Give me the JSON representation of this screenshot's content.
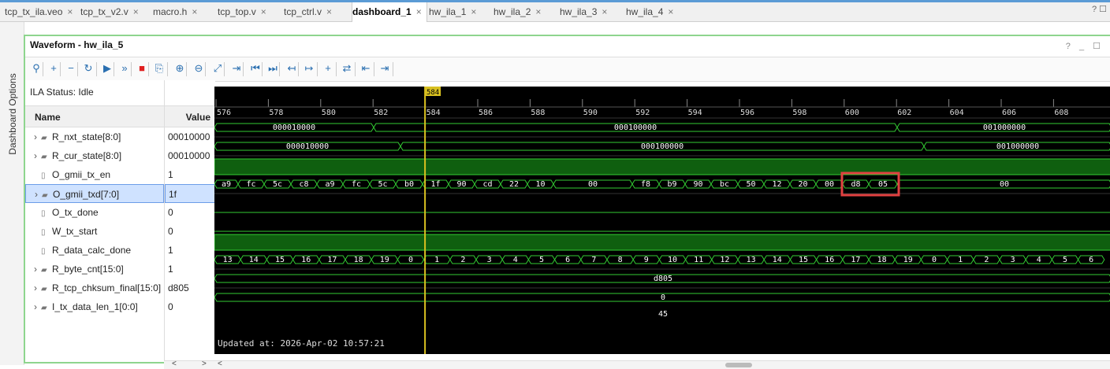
{
  "tabs": [
    {
      "label": "tcp_tx_ila.veo"
    },
    {
      "label": "tcp_tx_v2.v"
    },
    {
      "label": "macro.h"
    },
    {
      "label": "tcp_top.v"
    },
    {
      "label": "tcp_ctrl.v"
    },
    {
      "label": "dashboard_1"
    },
    {
      "label": "hw_ila_1"
    },
    {
      "label": "hw_ila_2"
    },
    {
      "label": "hw_ila_3"
    },
    {
      "label": "hw_ila_4"
    }
  ],
  "tab_close_glyph": "×",
  "tabbar_right": "? ☐",
  "side_tab": "Dashboard Options",
  "panel": {
    "title": "Waveform - hw_ila_5",
    "controls": "? _ ☐"
  },
  "ila_status": "ILA Status: Idle",
  "headers": {
    "name": "Name",
    "value": "Value"
  },
  "signals": [
    {
      "name": "R_nxt_state[8:0]",
      "value": "00010000",
      "expandable": true,
      "icon": "bus-icon"
    },
    {
      "name": "R_cur_state[8:0]",
      "value": "00010000",
      "expandable": true,
      "icon": "bus-icon"
    },
    {
      "name": "O_gmii_tx_en",
      "value": "1",
      "expandable": false,
      "icon": "wire-icon"
    },
    {
      "name": "O_gmii_txd[7:0]",
      "value": "1f",
      "expandable": true,
      "icon": "bus-icon",
      "selected": true
    },
    {
      "name": "O_tx_done",
      "value": "0",
      "expandable": false,
      "icon": "wire-icon"
    },
    {
      "name": "W_tx_start",
      "value": "0",
      "expandable": false,
      "icon": "wire-icon"
    },
    {
      "name": "R_data_calc_done",
      "value": "1",
      "expandable": false,
      "icon": "wire-icon"
    },
    {
      "name": "R_byte_cnt[15:0]",
      "value": "1",
      "expandable": true,
      "icon": "bus-icon"
    },
    {
      "name": "R_tcp_chksum_final[15:0]",
      "value": "d805",
      "expandable": true,
      "icon": "bus-icon"
    },
    {
      "name": "I_tx_data_len_1[0:0]",
      "value": "0",
      "expandable": true,
      "icon": "bus-icon"
    }
  ],
  "waveform": {
    "cursor_label": "584",
    "time_ticks": [
      "576",
      "578",
      "580",
      "582",
      "584",
      "586",
      "588",
      "590",
      "592",
      "594",
      "596",
      "598",
      "600",
      "602",
      "604",
      "606",
      "608"
    ],
    "nxt_state": {
      "segments": [
        "000010000",
        "000100000",
        "001000000"
      ]
    },
    "cur_state": {
      "segments": [
        "000010000",
        "000100000",
        "001000000"
      ]
    },
    "txd": {
      "bytes": [
        "a9",
        "fc",
        "5c",
        "c8",
        "a9",
        "fc",
        "5c",
        "b0",
        "1f",
        "90",
        "cd",
        "22",
        "10",
        "00",
        "f8",
        "b9",
        "90",
        "bc",
        "50",
        "12",
        "20",
        "00",
        "d8",
        "05",
        "00"
      ]
    },
    "byte_cnt": {
      "values": [
        "13",
        "14",
        "15",
        "16",
        "17",
        "18",
        "19",
        "0",
        "1",
        "2",
        "3",
        "4",
        "5",
        "6",
        "7",
        "8",
        "9",
        "10",
        "11",
        "12",
        "13",
        "14",
        "15",
        "16",
        "17",
        "18",
        "19",
        "0",
        "1",
        "2",
        "3",
        "4",
        "5",
        "6"
      ]
    },
    "chksum": "d805",
    "data_len": "0",
    "partial_label": "45",
    "updated": "Updated at: 2026-Apr-02 10:57:21",
    "highlight_color": "#e04040",
    "trace_color": "#33cc33",
    "cursor_color": "#d8c020"
  },
  "scroll_arrows": {
    "left": "<",
    "right": ">",
    "wave_left": "<"
  },
  "toolbar_icons": [
    "search-icon",
    "zoom-in-plus-icon",
    "zoom-out-minus-icon",
    "refresh-icon",
    "run-icon",
    "run-all-icon",
    "stop-icon",
    "export-icon",
    "zoom-in-icon",
    "zoom-out-icon",
    "zoom-fit-icon",
    "add-marker-icon",
    "go-first-icon",
    "go-last-icon",
    "prev-transition-icon",
    "next-transition-icon",
    "add-cursor-icon",
    "swap-icon",
    "marker-left-icon",
    "marker-right-icon"
  ],
  "toolbar_glyphs": [
    "⚲",
    "+",
    "−",
    "↻",
    "▶",
    "»",
    "■",
    "⎘",
    "⊕",
    "⊖",
    "⤢",
    "⇥",
    "⏮",
    "⏭",
    "↤",
    "↦",
    "+",
    "⇄",
    "⇤",
    "⇥"
  ]
}
